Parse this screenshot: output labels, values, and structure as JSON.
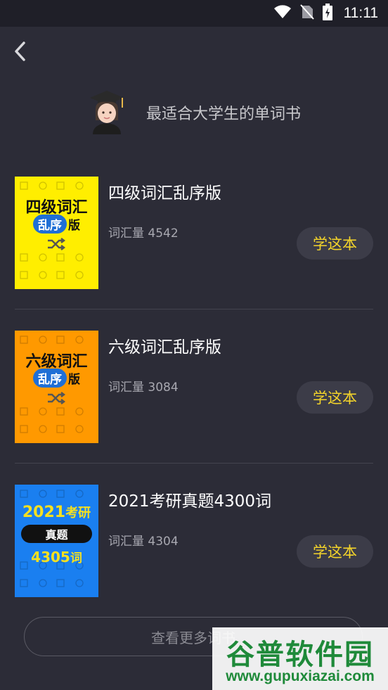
{
  "status_bar": {
    "time": "11:11",
    "icons": [
      "wifi-icon",
      "no-sim-icon",
      "battery-charging-icon"
    ]
  },
  "nav": {
    "back_icon": "chevron-left-icon"
  },
  "header": {
    "avatar_icon": "student-graduate-emoji",
    "tagline": "最适合大学生的单词书"
  },
  "books": [
    {
      "title": "四级词汇乱序版",
      "count_label": "词汇量 4542",
      "button_label": "学这本",
      "cover": {
        "bg": "#ffee00",
        "line1": "四级词汇",
        "pill": "乱序",
        "suffix": "版"
      }
    },
    {
      "title": "六级词汇乱序版",
      "count_label": "词汇量 3084",
      "button_label": "学这本",
      "cover": {
        "bg": "#ff9900",
        "line1": "六级词汇",
        "pill": "乱序",
        "suffix": "版"
      }
    },
    {
      "title": "2021考研真题4300词",
      "count_label": "词汇量 4304",
      "button_label": "学这本",
      "cover": {
        "bg": "#1a7ff0",
        "year": "2021",
        "word": "考研",
        "pill": "真题",
        "count": "4305",
        "unit": "词"
      }
    }
  ],
  "footer": {
    "more_label": "查看更多词书"
  },
  "watermark": {
    "brand": "谷普软件园",
    "url": "www.gupuxiazai.com"
  },
  "colors": {
    "background": "#2c2c37",
    "accent": "#f5d52a",
    "button_bg": "#3c3c48"
  }
}
